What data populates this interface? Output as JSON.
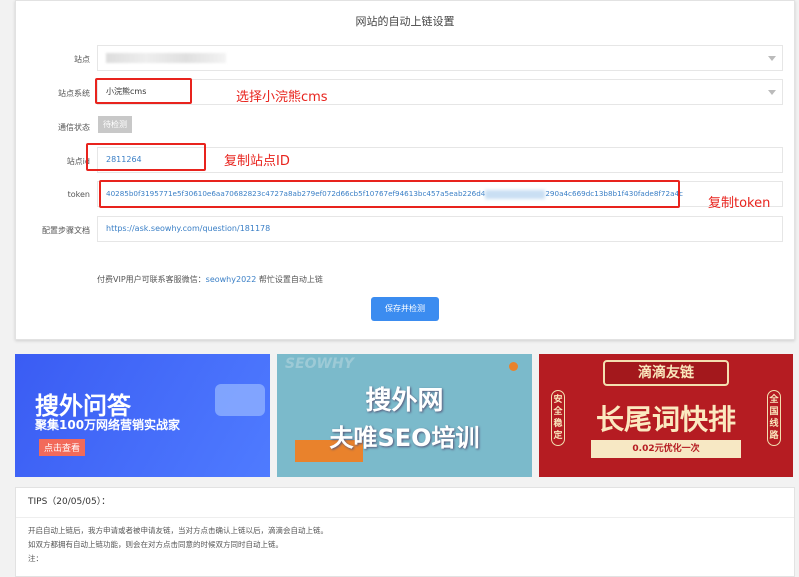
{
  "form": {
    "title": "网站的自动上链设置",
    "site_label": "站点",
    "system_label": "站点系统",
    "system_value": "小浣熊cms",
    "status_label": "通信状态",
    "status_value": "待检测",
    "siteid_label": "站点id",
    "siteid_value": "2811264",
    "token_label": "token",
    "token_value_start": "40285b0f3195771e5f30610e6aa70682823c4727a8ab279ef072d66cb5f10767ef94613bc457a5eab226d4",
    "token_value_end": "290a4c669dc13b8b1f430fade8f72a4c",
    "doc_label": "配置步骤文档",
    "doc_value": "https://ask.seowhy.com/question/181178",
    "vip_text": "付费VIP用户可联系客服微信：",
    "vip_wechat": "seowhy2022",
    "vip_suffix": " 帮忙设置自动上链",
    "save_button": "保存并检测"
  },
  "annotations": {
    "system": "选择小浣熊cms",
    "siteid": "复制站点ID",
    "token": "复制token"
  },
  "banners": [
    {
      "title": "搜外问答",
      "subtitle": "聚集100万网络营销实战家",
      "button": "点击查看"
    },
    {
      "watermark": "SEOWHY",
      "title": "搜外网",
      "subtitle": "夫唯SEO培训"
    },
    {
      "top": "滴滴友链",
      "title": "长尾词快排",
      "left": "安全稳定",
      "right": "全国线路",
      "price": "0.02元优化一次"
    }
  ],
  "tips": {
    "title": "TIPS（20/05/05）：",
    "lines": [
      "开启自动上链后，我方申请或者被申请友链，当对方点击确认上链以后，滴滴会自动上链。",
      "如双方都拥有自动上链功能，则会在对方点击同意的时候双方同时自动上链。",
      "注："
    ]
  }
}
